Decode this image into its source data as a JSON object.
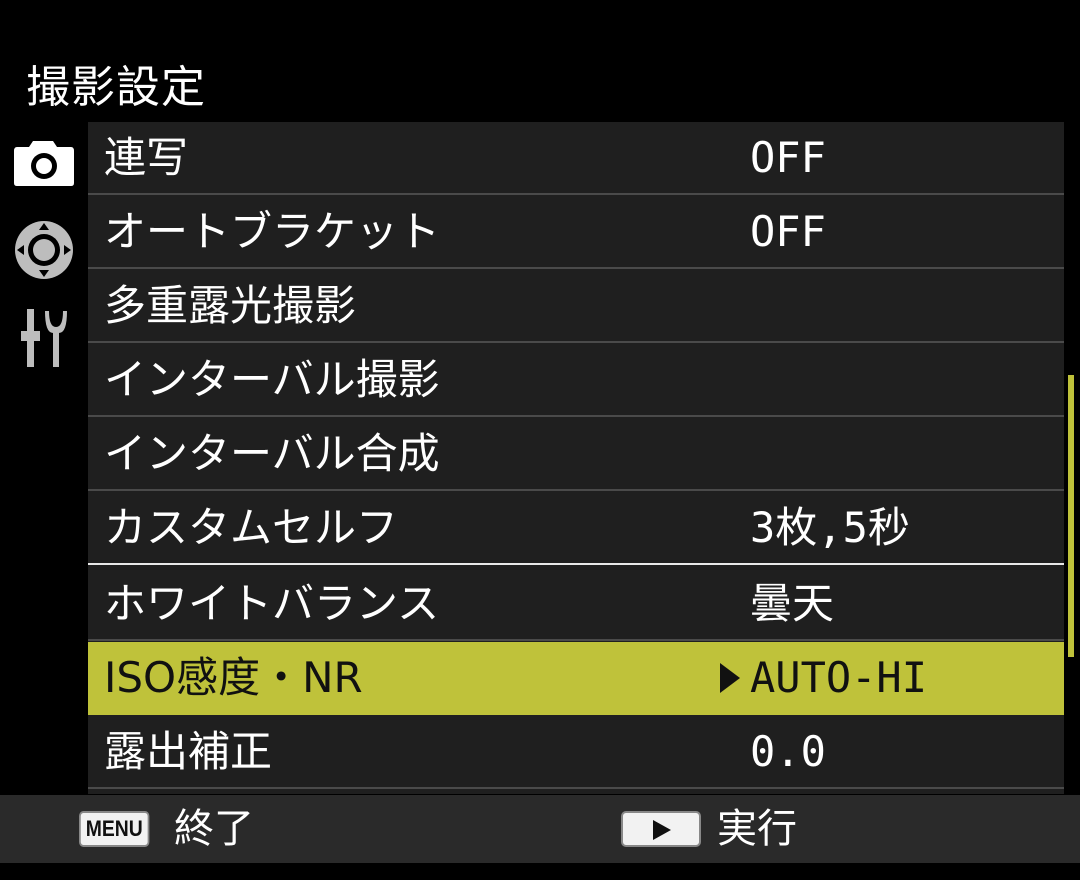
{
  "header": {
    "title": "撮影設定"
  },
  "tabs": [
    {
      "icon": "camera-icon",
      "active": true
    },
    {
      "icon": "playback-dial-icon",
      "active": false
    },
    {
      "icon": "tools-icon",
      "active": false
    }
  ],
  "menu": {
    "items": [
      {
        "label": "連写",
        "value": "OFF"
      },
      {
        "label": "オートブラケット",
        "value": "OFF"
      },
      {
        "label": "多重露光撮影",
        "value": ""
      },
      {
        "label": "インターバル撮影",
        "value": ""
      },
      {
        "label": "インターバル合成",
        "value": ""
      },
      {
        "label": "カスタムセルフ",
        "value": "3枚,5秒"
      },
      {
        "label": "ホワイトバランス",
        "value": "曇天"
      },
      {
        "label": "ISO感度・NR",
        "value": "AUTO-HI",
        "selected": true
      },
      {
        "label": "露出補正",
        "value": "0.0"
      }
    ],
    "scroll_position": 0.45
  },
  "footer": {
    "menu_key": "MENU",
    "exit_label": "終了",
    "exec_label": "実行"
  },
  "colors": {
    "accent": "#bfc23a",
    "background": "#000000",
    "panel": "#1f1f1f"
  }
}
